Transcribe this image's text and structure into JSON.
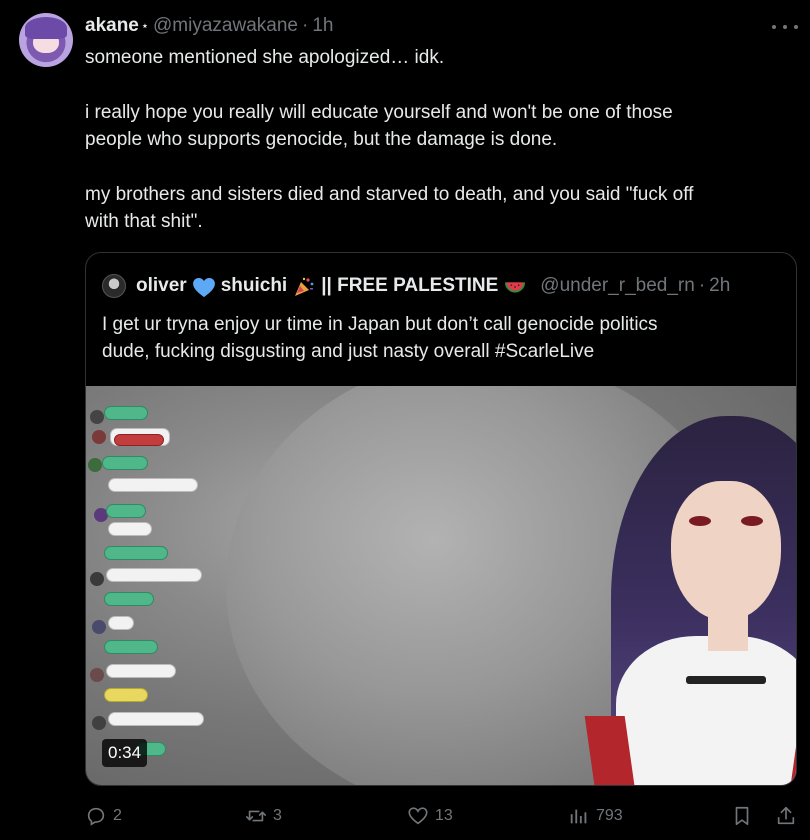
{
  "tweet": {
    "author_name": "akane",
    "author_badge": "⋆",
    "handle": "@miyazawakane",
    "separator": "·",
    "time": "1h",
    "text_lines": [
      "someone mentioned she apologized… idk.",
      "i really hope you really will educate yourself and won't be one of those",
      "people who supports genocide, but the damage is done.",
      "my brothers and sisters died and starved to death, and you said \"fuck off",
      "with that shit\"."
    ]
  },
  "quote": {
    "name_part1": "oliver",
    "name_part2": "shuichi",
    "name_part3": "|| FREE PALESTINE",
    "handle": "@under_r_bed_rn",
    "separator": "·",
    "time": "2h",
    "text_lines": [
      "I get ur tryna enjoy ur time in Japan but don’t call genocide politics",
      "dude, fucking disgusting and just nasty overall #ScarleLive"
    ],
    "media": {
      "duration": "0:34"
    }
  },
  "actions": {
    "replies": "2",
    "reposts": "3",
    "likes": "13",
    "views": "793"
  },
  "icons": {
    "more": "more-horizontal-icon",
    "reply": "reply-icon",
    "repost": "repost-icon",
    "like": "heart-icon",
    "views": "views-icon",
    "bookmark": "bookmark-icon",
    "share": "share-icon"
  },
  "colors": {
    "background": "#000000",
    "text": "#e7e9ea",
    "muted": "#71767b",
    "border": "#2f3336",
    "blue_heart": "#5ea9f5"
  }
}
